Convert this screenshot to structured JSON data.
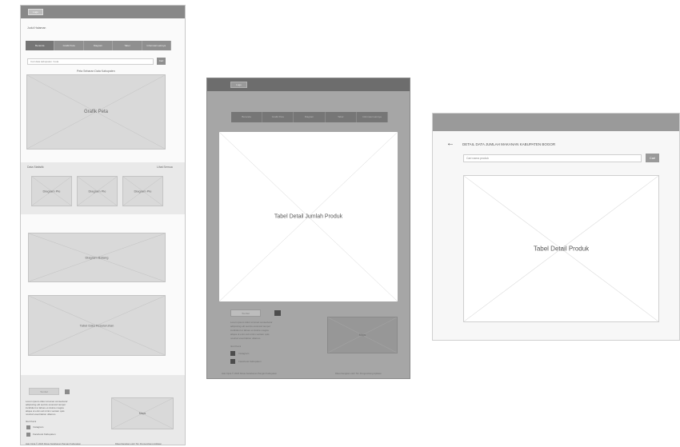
{
  "frame1": {
    "logo": "Logo",
    "page_heading": "Judul Halaman",
    "tabs": [
      "Beranda",
      "Grafik Peta",
      "Diagram",
      "Tabel",
      "Informasi Lainnya"
    ],
    "search_placeholder": "Cari data kabupaten / kota",
    "search_button": "Cari",
    "caption": "Peta Sebaran Data Kabupaten",
    "map_label": "Grafik Peta",
    "section_title": "Data Statistik",
    "section_link": "Lihat Semua",
    "pie_labels": [
      "Diagram Pie",
      "Diagram Pie",
      "Diagram Pie"
    ],
    "chart1_label": "Diagram Batang",
    "chart2_label": "Tabel Data Keseluruhan",
    "footer_button": "Tombol",
    "footer_text": [
      "Lorem ipsum dolor sit amet consectetur",
      "adipiscing elit sed do eiusmod tempor",
      "incididunt ut labore et dolore magna",
      "aliqua ut enim ad minim veniam quis",
      "nostrud exercitation ullamco."
    ],
    "follow_label": "Ikuti Kami",
    "social": [
      "Instagram",
      "Facebook Kabupaten"
    ],
    "map_small": "Maps",
    "copyright": "Hak Cipta © 2023 Dinas Ketahanan Pangan Kabupaten",
    "credit": "Dikembangkan oleh Tim Pengembang Aplikasi"
  },
  "frame2": {
    "logo": "Logo",
    "tabs": [
      "Beranda",
      "Grafik Peta",
      "Diagram",
      "Tabel",
      "Informasi Lainnya"
    ],
    "modal_label": "Tabel Detail Jumlah Produk",
    "footer_button": "Tombol",
    "footer_text": [
      "Lorem ipsum dolor sit amet consectetur",
      "adipiscing elit sed do eiusmod tempor",
      "incididunt ut labore et dolore magna",
      "aliqua ut enim ad minim veniam quis",
      "nostrud exercitation ullamco."
    ],
    "follow_label": "Ikuti Kami",
    "social": [
      "Instagram",
      "Facebook Kabupaten"
    ],
    "map_small": "Maps",
    "copyright": "Hak Cipta © 2023 Dinas Ketahanan Pangan Kabupaten",
    "credit": "Dikembangkan oleh Tim Pengembang Aplikasi"
  },
  "frame3": {
    "back_glyph": "←",
    "title": "DETAIL DATA JUMLAH MAKANAN KABUPATEN BOGOR",
    "search_placeholder": "Cari nama produk",
    "search_button": "Cari",
    "table_label": "Tabel Detail Produk"
  }
}
